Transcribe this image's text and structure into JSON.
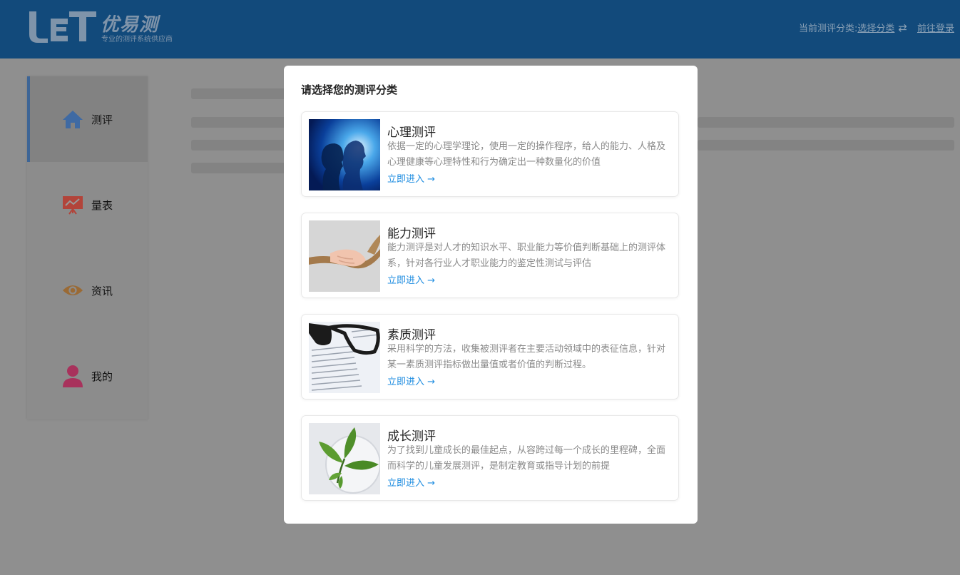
{
  "header": {
    "logo_title": "优易测",
    "logo_subtitle": "专业的测评系统供应商",
    "category_label": "当前测评分类:",
    "category_link": "选择分类",
    "swap_glyph": "⇄",
    "login_link": "前往登录"
  },
  "sidebar": {
    "items": [
      {
        "label": "测评",
        "icon": "home-icon",
        "color": "#3f6aa3"
      },
      {
        "label": "量表",
        "icon": "presentation-chart-icon",
        "color": "#b2443a"
      },
      {
        "label": "资讯",
        "icon": "eye-icon",
        "color": "#9a6a35"
      },
      {
        "label": "我的",
        "icon": "user-icon",
        "color": "#a8325c"
      }
    ]
  },
  "modal": {
    "title": "请选择您的测评分类",
    "cards": [
      {
        "title": "心理测评",
        "description": "依据一定的心理学理论，使用一定的操作程序，给人的能力、人格及心理健康等心理特性和行为确定出一种数量化的价值",
        "link": "立即进入 →",
        "image": "psychology-image"
      },
      {
        "title": "能力测评",
        "description": "能力测评是对人才的知识水平、职业能力等价值判断基础上的测评体系，针对各行业人才职业能力的鉴定性测试与评估",
        "link": "立即进入 →",
        "image": "rope-hands-image"
      },
      {
        "title": "素质测评",
        "description": "采用科学的方法，收集被测评者在主要活动领域中的表征信息，针对某一素质测评指标做出量值或者价值的判断过程。",
        "link": "立即进入 →",
        "image": "glasses-book-image"
      },
      {
        "title": "成长测评",
        "description": "为了找到儿童成长的最佳起点，从容跨过每一个成长的里程碑，全面而科学的儿童发展测评，是制定教育或指导计划的前提",
        "link": "立即进入 →",
        "image": "sprout-leaves-image"
      }
    ]
  },
  "colors": {
    "header_bg": "#124a7b",
    "overlay_bg": "#8f8f8f",
    "link": "#1f8de0",
    "active_bar": "#3d6596"
  }
}
